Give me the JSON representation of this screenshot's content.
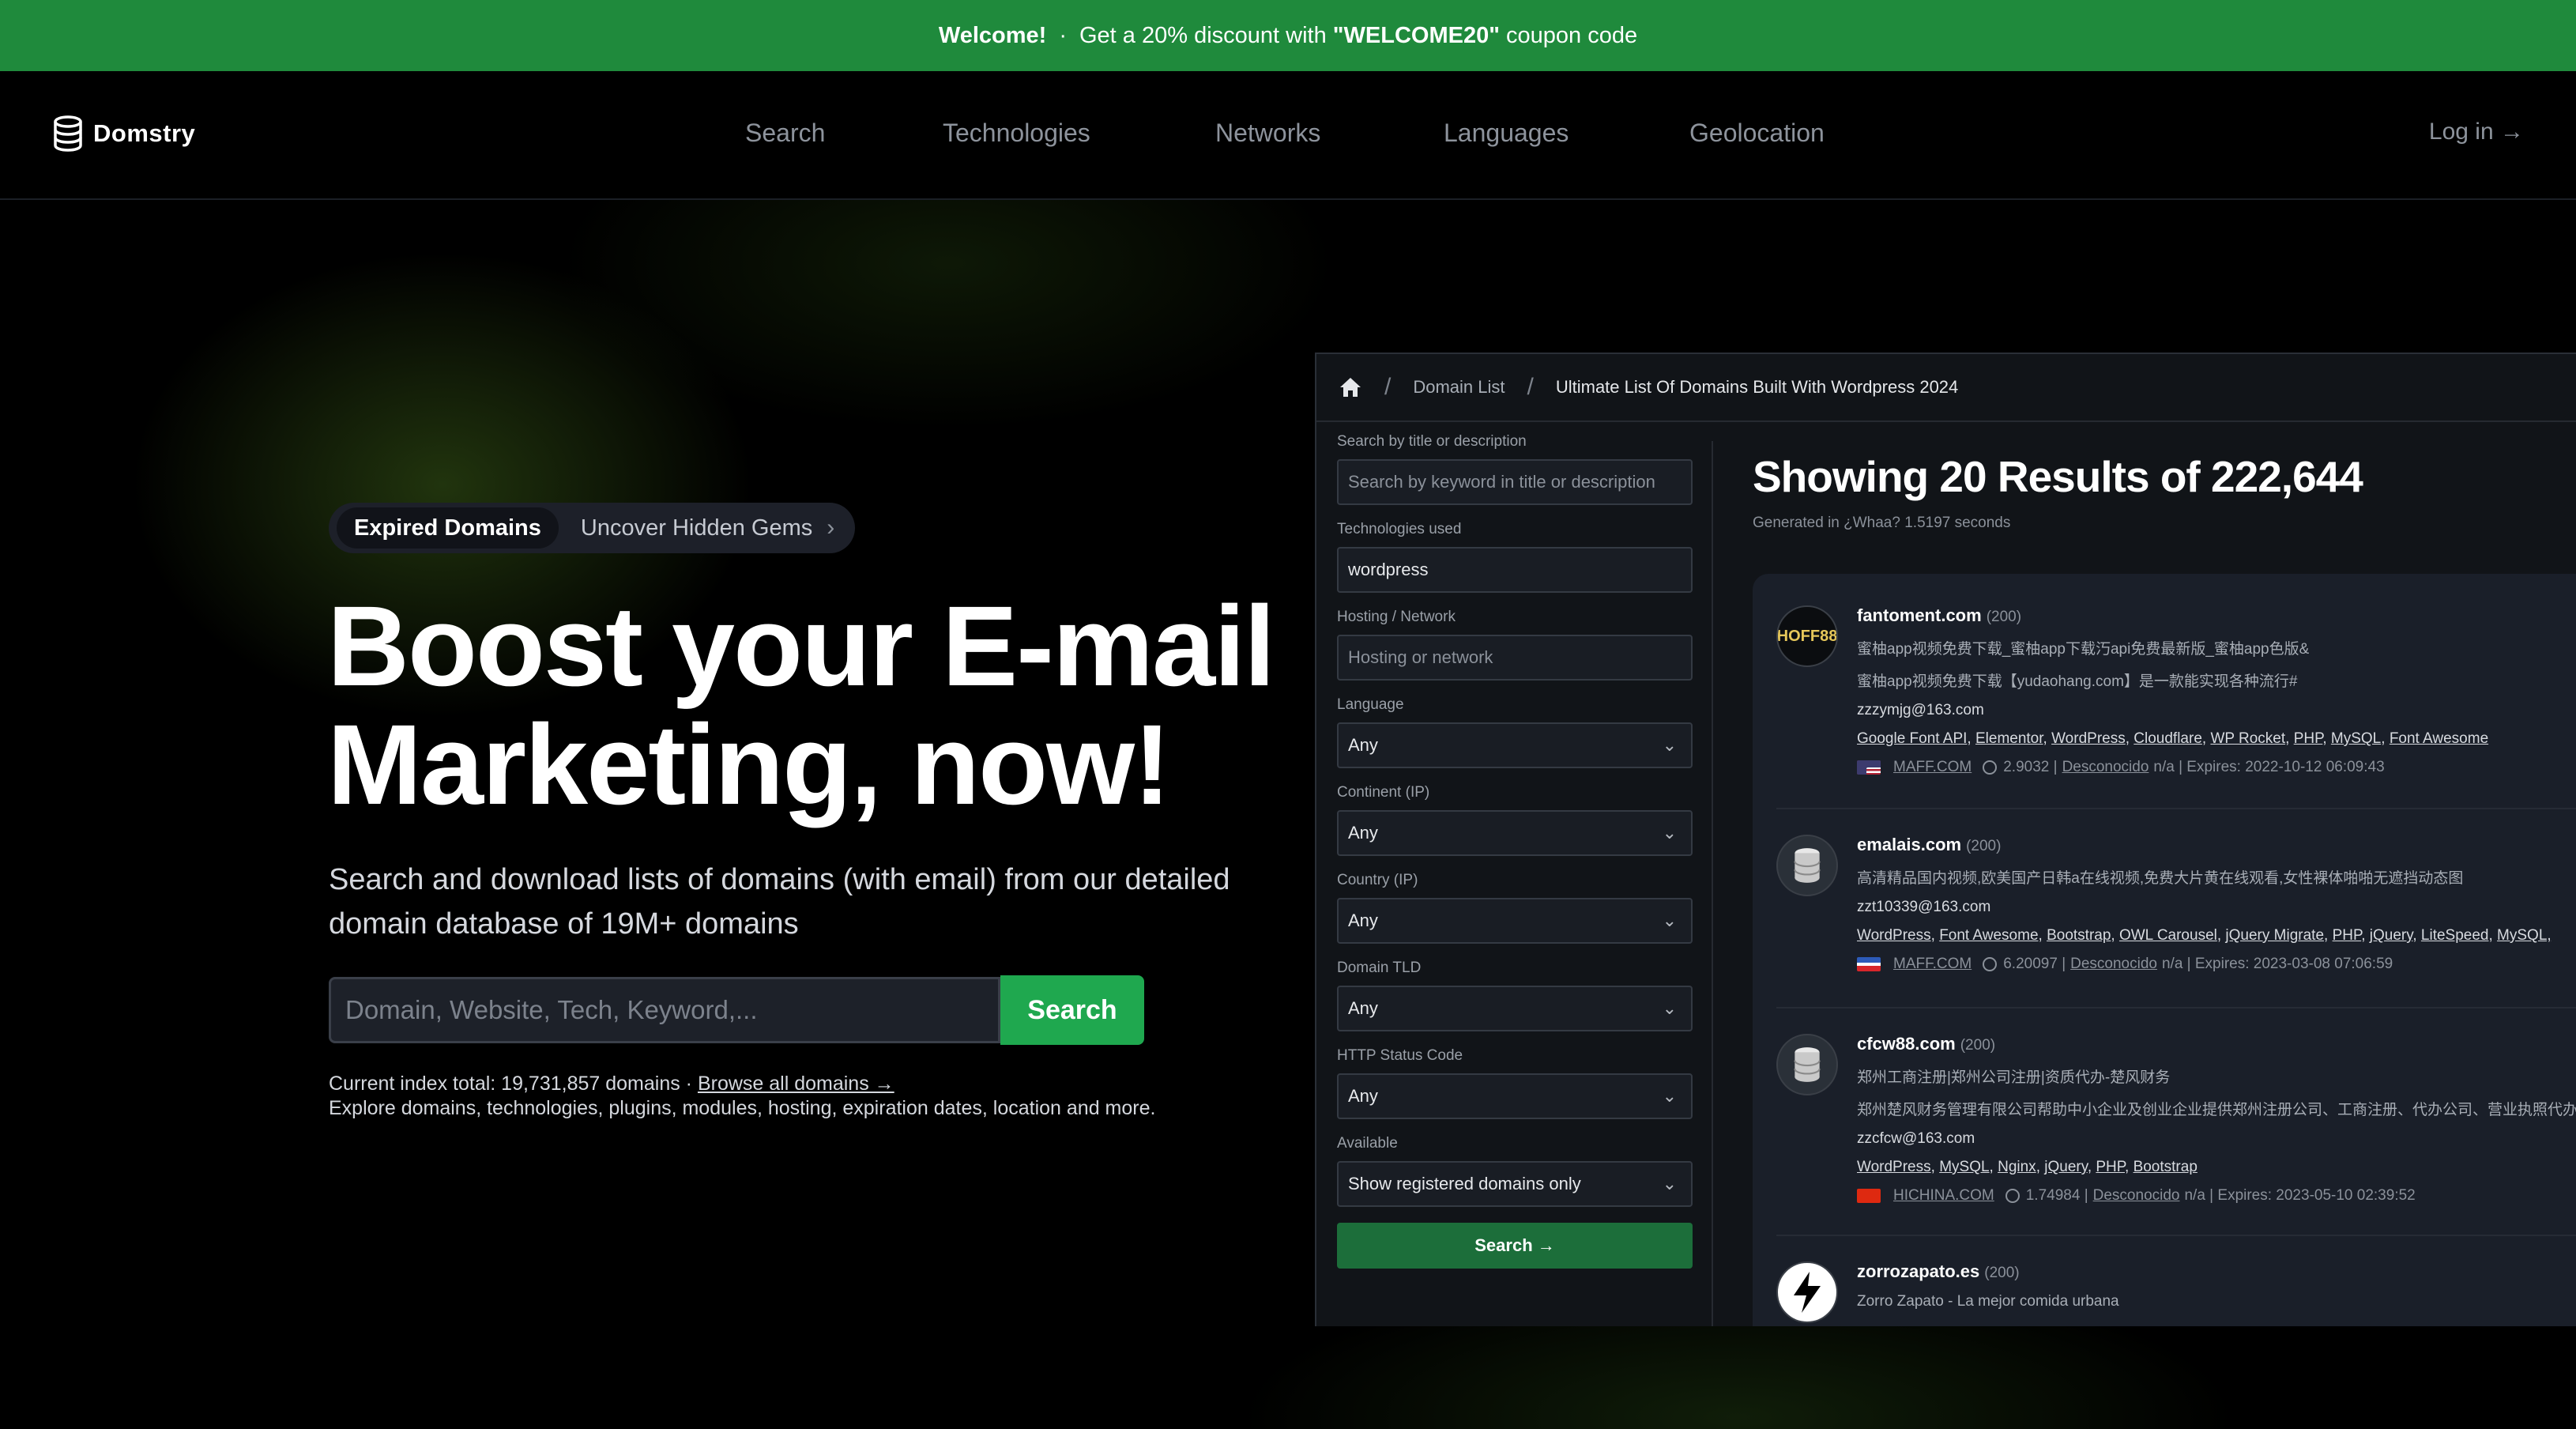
{
  "banner": {
    "welcome": "Welcome!",
    "separator": "·",
    "text_before": "Get a 20% discount with",
    "code": "\"WELCOME20\"",
    "text_after": "coupon code"
  },
  "nav": {
    "brand": "Domstry",
    "links": [
      "Search",
      "Technologies",
      "Networks",
      "Languages",
      "Geolocation"
    ],
    "login": "Log in →"
  },
  "hero": {
    "pill_tag": "Expired Domains",
    "pill_text": "Uncover Hidden Gems",
    "pill_chevron": "›",
    "headline_line1": "Boost your E-mail",
    "headline_line2": "Marketing, now!",
    "subtitle": "Search and download lists of domains (with email) from our detailed domain database of 19M+ domains",
    "search_placeholder": "Domain, Website, Tech, Keyword,...",
    "search_button": "Search",
    "index_text": "Current index total: 19,731,857 domains ·",
    "browse_link": "Browse all domains →",
    "explore_text": "Explore domains, technologies, plugins, modules, hosting, expiration dates, location and more."
  },
  "panel": {
    "breadcrumb": {
      "sep": "/",
      "item1": "Domain List",
      "item2": "Ultimate List Of Domains Built With Wordpress 2024"
    },
    "filters": {
      "search_label": "Search by title or description",
      "search_placeholder": "Search by keyword in title or description",
      "tech_label": "Technologies used",
      "tech_value": "wordpress",
      "hosting_label": "Hosting / Network",
      "hosting_placeholder": "Hosting or network",
      "language_label": "Language",
      "language_value": "Any",
      "continent_label": "Continent (IP)",
      "continent_value": "Any",
      "country_label": "Country (IP)",
      "country_value": "Any",
      "tld_label": "Domain TLD",
      "tld_value": "Any",
      "status_label": "HTTP Status Code",
      "status_value": "Any",
      "available_label": "Available",
      "available_value": "Show registered domains only",
      "search_button": "Search →"
    },
    "results_title": "Showing 20 Results of 222,644",
    "results_sub": "Generated in ¿Whaa? 1.5197 seconds",
    "results": [
      {
        "avatar": "HOFF88",
        "domain": "fantoment.com",
        "code": "(200)",
        "line1": "蜜柚app视频免费下载_蜜柚app下载汅api免费最新版_蜜柚app色版&",
        "line2": "蜜柚app视频免费下载【yudaohang.com】是一款能实现各种流行#",
        "email": "zzzymjg@163.com",
        "techs": [
          "Google Font API",
          "Elementor",
          "WordPress",
          "Cloudflare",
          "WP Rocket",
          "PHP",
          "MySQL",
          "Font Awesome"
        ],
        "registrar": "MAFF.COM",
        "time": "2.9032",
        "pipe": "|",
        "location": "Desconocido",
        "expires": "n/a | Expires: 2022-10-12 06:09:43"
      },
      {
        "avatar": "db",
        "domain": "emalais.com",
        "code": "(200)",
        "line1": "高清精品国内视频,欧美国产日韩a在线视频,免费大片黄在线观看,女性裸体啪啪无遮挡动态图",
        "email": "zzt10339@163.com",
        "techs": [
          "WordPress",
          "Font Awesome",
          "Bootstrap",
          "OWL Carousel",
          "jQuery Migrate",
          "PHP",
          "jQuery",
          "LiteSpeed",
          "MySQL,"
        ],
        "registrar": "MAFF.COM",
        "time": "6.20097",
        "pipe": "|",
        "location": "Desconocido",
        "expires": "n/a | Expires: 2023-03-08 07:06:59"
      },
      {
        "avatar": "db",
        "domain": "cfcw88.com",
        "code": "(200)",
        "line1": "郑州工商注册|郑州公司注册|资质代办-楚风财务",
        "line2": "郑州楚风财务管理有限公司帮助中小企业及创业企业提供郑州注册公司、工商注册、代办公司、营业执照代办、",
        "email": "zzcfcw@163.com",
        "techs": [
          "WordPress",
          "MySQL",
          "Nginx",
          "jQuery",
          "PHP",
          "Bootstrap"
        ],
        "registrar": "HICHINA.COM",
        "time": "1.74984",
        "pipe": "|",
        "location": "Desconocido",
        "expires": "n/a | Expires: 2023-05-10 02:39:52"
      },
      {
        "avatar": "zz",
        "domain": "zorrozapato.es",
        "code": "(200)",
        "line1": "Zorro Zapato - La mejor comida urbana"
      }
    ]
  }
}
